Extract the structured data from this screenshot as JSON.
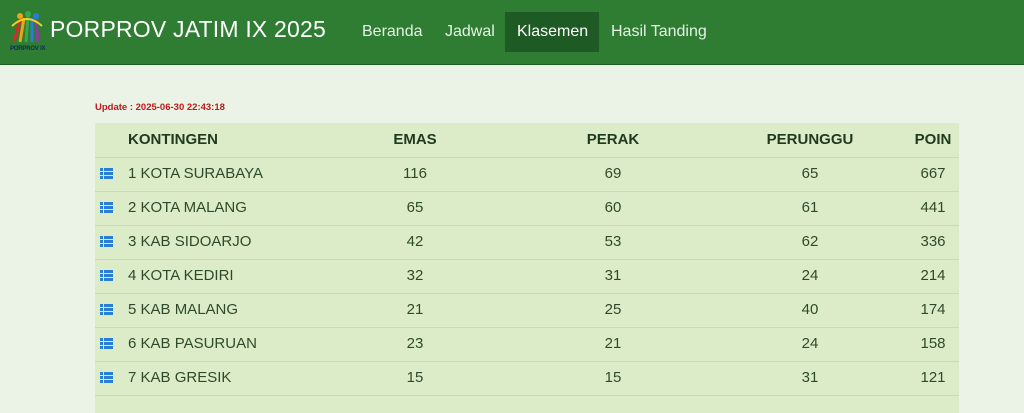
{
  "header": {
    "logo_text": "PORPROV IX",
    "title": "PORPROV JATIM IX 2025",
    "nav": [
      {
        "label": "Beranda",
        "active": false
      },
      {
        "label": "Jadwal",
        "active": false
      },
      {
        "label": "Klasemen",
        "active": true
      },
      {
        "label": "Hasil Tanding",
        "active": false
      }
    ]
  },
  "update_text": "Update : 2025-06-30 22:43:18",
  "table": {
    "columns": [
      "KONTINGEN",
      "EMAS",
      "PERAK",
      "PERUNGGU",
      "POIN"
    ],
    "rows": [
      {
        "name": "1 KOTA SURABAYA",
        "emas": "116",
        "perak": "69",
        "perunggu": "65",
        "poin": "667"
      },
      {
        "name": "2 KOTA MALANG",
        "emas": "65",
        "perak": "60",
        "perunggu": "61",
        "poin": "441"
      },
      {
        "name": "3 KAB SIDOARJO",
        "emas": "42",
        "perak": "53",
        "perunggu": "62",
        "poin": "336"
      },
      {
        "name": "4 KOTA KEDIRI",
        "emas": "32",
        "perak": "31",
        "perunggu": "24",
        "poin": "214"
      },
      {
        "name": "5 KAB MALANG",
        "emas": "21",
        "perak": "25",
        "perunggu": "40",
        "poin": "174"
      },
      {
        "name": "6 KAB PASURUAN",
        "emas": "23",
        "perak": "21",
        "perunggu": "24",
        "poin": "158"
      },
      {
        "name": "7 KAB GRESIK",
        "emas": "15",
        "perak": "15",
        "perunggu": "31",
        "poin": "121"
      }
    ]
  },
  "colors": {
    "nav_bg": "#2e7d32",
    "nav_active": "#1e5a24",
    "table_bg": "#dcecc8",
    "update_red": "#c01818",
    "icon_blue": "#2a7fd4"
  },
  "icons": {
    "row_icon": "list-icon",
    "logo": "porprov-logo-icon"
  }
}
